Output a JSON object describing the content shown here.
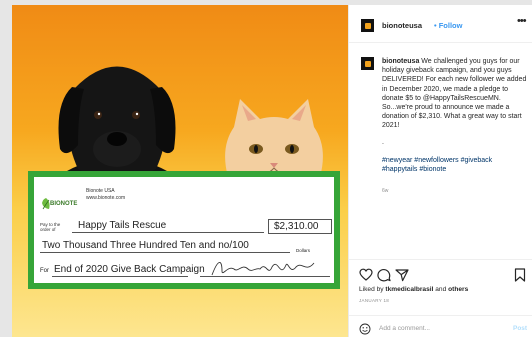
{
  "check": {
    "payer_name": "Bionote USA",
    "payer_site": "www.bionote.com",
    "brand": "BIONOTE",
    "pay_to_label": "Pay to the order of",
    "payee": "Happy Tails Rescue",
    "amount": "$2,310.00",
    "amount_words": "Two Thousand Three Hundred Ten and no/100",
    "dollars_label": "Dollars",
    "for_label": "For",
    "memo": "End of 2020 Give Back Campaign"
  },
  "post": {
    "username": "bionoteusa",
    "follow_label": "• Follow",
    "more_label": "•••",
    "caption_user": "bionoteusa",
    "caption_body": " We challenged you guys for our holiday giveback campaign, and you guys DELIVERED! For each new follower we added in December 2020, we made a pledge to donate $5 to @HappyTailsRescueMN. So...we're proud to announce we made a donation of $2,310. What a great way to start 2021!",
    "caption_dot": ".",
    "hashtags": "#newyear #newfollowers #giveback #happytails #bionote",
    "time_ago": "6w",
    "liked_by_prefix": "Liked by ",
    "liked_by_user": "tkmedicalbrasil",
    "liked_by_mid": " and ",
    "liked_by_others": "others",
    "date": "JANUARY 18",
    "comment_placeholder": "Add a comment...",
    "post_label": "Post"
  },
  "colors": {
    "accent_blue": "#3897f0",
    "hashtag": "#003569",
    "check_green": "#36a538",
    "logo_orange": "#f2a21c"
  }
}
